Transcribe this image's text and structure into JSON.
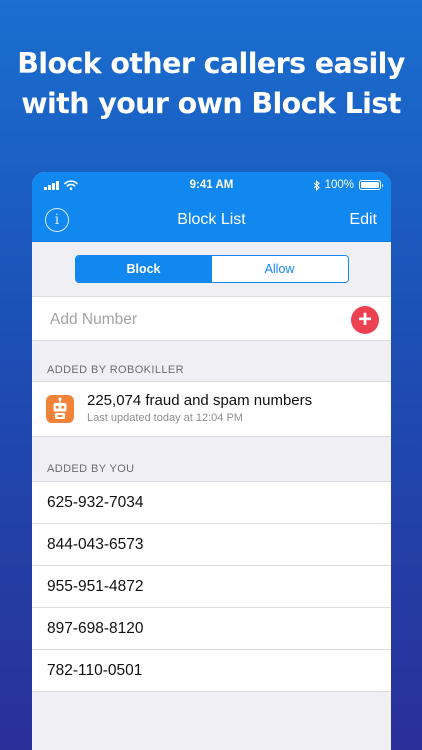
{
  "headline": {
    "line1": "Block other callers easily",
    "line2": "with your own Block List"
  },
  "status_bar": {
    "time": "9:41 AM",
    "battery": "100%",
    "battery_level": 1.0
  },
  "nav": {
    "info_glyph": "i",
    "title": "Block List",
    "edit_label": "Edit"
  },
  "segment": {
    "block_label": "Block",
    "allow_label": "Allow",
    "selected": "Block"
  },
  "add_number": {
    "placeholder": "Add Number",
    "add_glyph": "+"
  },
  "robokiller_section": {
    "header": "ADDED BY ROBOKILLER",
    "title": "225,074 fraud and spam numbers",
    "subtitle": "Last updated today at 12:04 PM",
    "icon": "robot-icon"
  },
  "you_section": {
    "header": "ADDED BY YOU",
    "numbers": [
      "625-932-7034",
      "844-043-6573",
      "955-951-4872",
      "897-698-8120",
      "782-110-0501"
    ]
  },
  "colors": {
    "accent": "#1187f0",
    "add_button": "#ec4150",
    "robokiller_icon": "#f4833a",
    "background_top": "#1a6fd0",
    "background_bottom": "#2a2f9a"
  }
}
